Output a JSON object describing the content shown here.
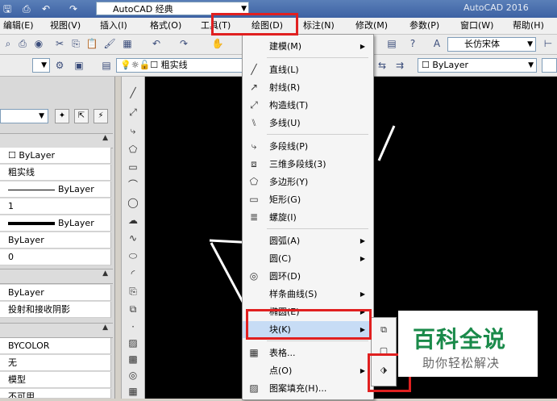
{
  "quick_access": {
    "icons": [
      "save-icon",
      "print-icon",
      "undo-icon",
      "redo-icon"
    ],
    "workspace_value": "AutoCAD 经典",
    "app_title": "AutoCAD 2016"
  },
  "menubar": {
    "items": [
      {
        "label": "编辑(E)"
      },
      {
        "label": "视图(V)"
      },
      {
        "label": "插入(I)"
      },
      {
        "label": "格式(O)"
      },
      {
        "label": "工具(T)"
      },
      {
        "label": "绘图(D)"
      },
      {
        "label": "标注(N)"
      },
      {
        "label": "修改(M)"
      },
      {
        "label": "参数(P)"
      },
      {
        "label": "窗口(W)"
      },
      {
        "label": "帮助(H)"
      }
    ]
  },
  "toolbar": {
    "font_combo": "长仿宋体"
  },
  "layer_toolbar": {
    "layer_combo": "粗实线",
    "color_combo": "ByLayer"
  },
  "properties": {
    "general_rows": [
      {
        "value": "☐ ByLayer"
      },
      {
        "value": "粗实线"
      },
      {
        "value": "ByLayer",
        "line": "thin"
      },
      {
        "value": "1"
      },
      {
        "value": "ByLayer",
        "line": "thick"
      },
      {
        "value": "ByLayer"
      },
      {
        "value": "0"
      }
    ],
    "view_rows": [
      {
        "value": "ByLayer"
      },
      {
        "value": "投射和接收阴影"
      }
    ],
    "misc_rows": [
      {
        "value": "BYCOLOR"
      },
      {
        "value": "无"
      },
      {
        "value": "模型"
      },
      {
        "value": "不可用"
      }
    ]
  },
  "draw_menu": {
    "items": [
      {
        "label": "建模(M)",
        "icon": "",
        "submenu": true
      },
      {
        "label": "直线(L)",
        "icon": "line-icon"
      },
      {
        "label": "射线(R)",
        "icon": "ray-icon"
      },
      {
        "label": "构造线(T)",
        "icon": "construction-line-icon"
      },
      {
        "label": "多线(U)",
        "icon": "multiline-icon"
      },
      {
        "label": "多段线(P)",
        "icon": "polyline-icon"
      },
      {
        "label": "三维多段线(3)",
        "icon": "3d-polyline-icon"
      },
      {
        "label": "多边形(Y)",
        "icon": "polygon-icon"
      },
      {
        "label": "矩形(G)",
        "icon": "rectangle-icon"
      },
      {
        "label": "螺旋(I)",
        "icon": "helix-icon"
      },
      {
        "label": "圆弧(A)",
        "icon": "",
        "submenu": true
      },
      {
        "label": "圆(C)",
        "icon": "",
        "submenu": true
      },
      {
        "label": "圆环(D)",
        "icon": "donut-icon"
      },
      {
        "label": "样条曲线(S)",
        "icon": "",
        "submenu": true
      },
      {
        "label": "椭圆(E)",
        "icon": "",
        "submenu": true
      },
      {
        "label": "块(K)",
        "icon": "",
        "submenu": true,
        "highlighted": true
      },
      {
        "label": "表格...",
        "icon": "table-icon"
      },
      {
        "label": "点(O)",
        "icon": "",
        "submenu": true
      },
      {
        "label": "图案填充(H)...",
        "icon": "hatch-icon"
      }
    ]
  },
  "block_submenu": {
    "icons": [
      "create-block-icon",
      "write-block-icon",
      "define-attributes-icon"
    ]
  },
  "watermark": {
    "title": "百科全说",
    "subtitle": "助你轻松解决"
  },
  "colors": {
    "highlight_box": "#e02020",
    "watermark_green": "#1a8a4a",
    "canvas": "#000000"
  }
}
